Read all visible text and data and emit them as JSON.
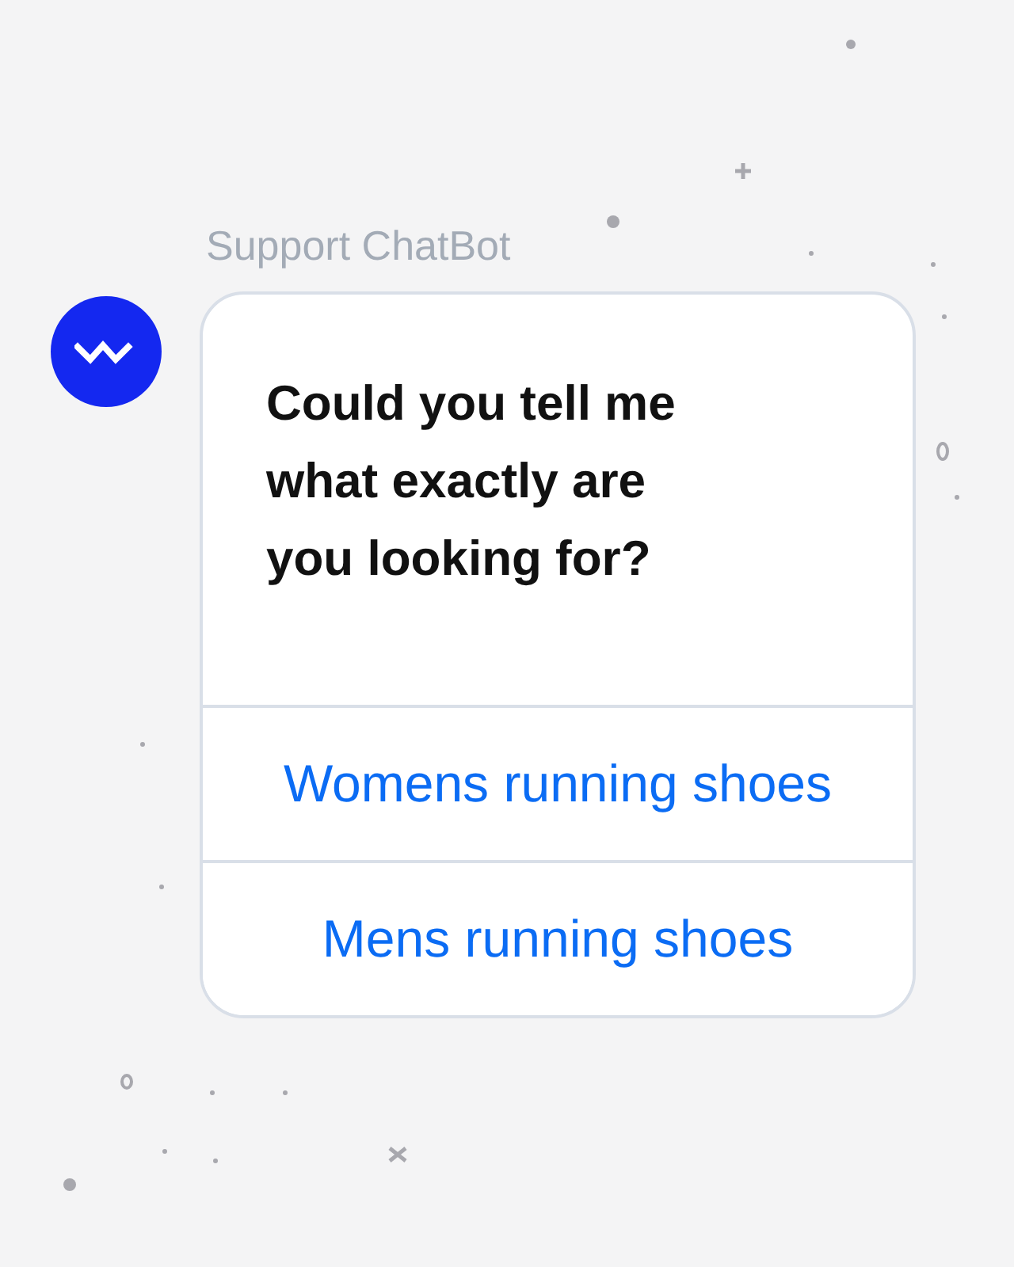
{
  "bot": {
    "name": "Support ChatBot"
  },
  "message": {
    "text": "Could you tell me what exactly are you looking for?"
  },
  "options": [
    {
      "label": "Womens running shoes"
    },
    {
      "label": "Mens running shoes"
    }
  ]
}
